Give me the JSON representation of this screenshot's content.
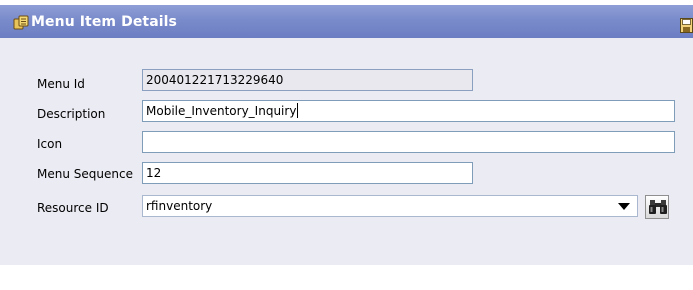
{
  "panel": {
    "title": "Menu Item Details",
    "title_icon": "menu-item-icon",
    "save_icon": "save-icon"
  },
  "form": {
    "menu_id": {
      "label": "Menu Id",
      "value": "200401221713229640"
    },
    "description": {
      "label": "Description",
      "value": "Mobile_Inventory_Inquiry"
    },
    "icon": {
      "label": "Icon",
      "value": ""
    },
    "menu_sequence": {
      "label": "Menu Sequence",
      "value": "12"
    },
    "resource_id": {
      "label": "Resource ID",
      "value": "rfinventory",
      "lookup_icon": "binoculars-icon"
    }
  },
  "colors": {
    "titlebar": "#7a8bcb",
    "body_background": "#ebebf3",
    "field_border": "#7f9db9"
  }
}
